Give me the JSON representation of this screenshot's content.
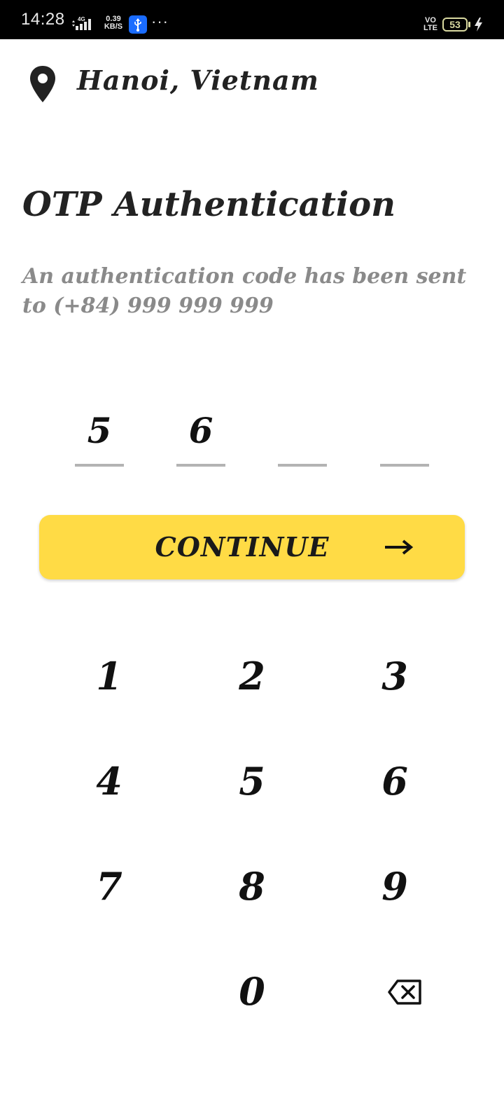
{
  "status_bar": {
    "time": "14:28",
    "network": "4G",
    "speed_value": "0.39",
    "speed_unit": "KB/S",
    "more": "···",
    "volte_top": "VO",
    "volte_bottom": "LTE",
    "battery": "53",
    "icons": [
      "signal-icon",
      "usb-icon",
      "battery-icon",
      "charging-icon"
    ]
  },
  "location": {
    "text": "Hanoi,  Vietnam",
    "icon": "map-pin-icon"
  },
  "page": {
    "title": "OTP Authentication",
    "subtitle": "An authentication code has been sent to (+84) 999 999 999"
  },
  "otp": {
    "digits": [
      "5",
      "6",
      "",
      ""
    ]
  },
  "continue": {
    "label": "CONTINUE",
    "icon": "arrow-right-icon"
  },
  "keypad": {
    "keys": [
      "1",
      "2",
      "3",
      "4",
      "5",
      "6",
      "7",
      "8",
      "9",
      "0"
    ],
    "backspace_icon": "backspace-icon"
  },
  "colors": {
    "accent": "#ffdb45",
    "text": "#111111",
    "muted": "#8a8a8a",
    "underline": "#b3b3b3"
  }
}
